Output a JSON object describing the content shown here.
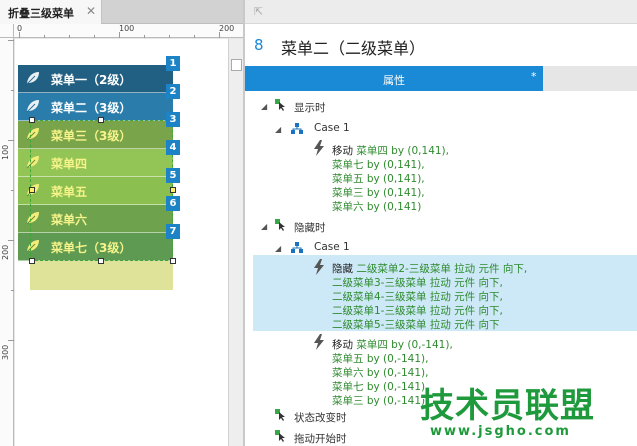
{
  "document_tab": {
    "title": "折叠三级菜单",
    "close": "✕"
  },
  "ruler": {
    "top_labels": [
      "0",
      "100",
      "200"
    ],
    "left_labels": [
      "100",
      "200",
      "300"
    ]
  },
  "canvas": {
    "menu_items": [
      {
        "label": "菜单一（2级）",
        "color": "#215f83"
      },
      {
        "label": "菜单二（3级）",
        "color": "#2a7dab"
      },
      {
        "label": "菜单三（3级）",
        "color": "#7aa44a"
      },
      {
        "label": "菜单四",
        "color": "#93c456"
      },
      {
        "label": "菜单五",
        "color": "#8bbf50"
      },
      {
        "label": "菜单六",
        "color": "#6fa24d"
      },
      {
        "label": "菜单七（3级）",
        "color": "#5e9a52"
      }
    ],
    "badges": [
      "1",
      "2",
      "3",
      "4",
      "5",
      "6",
      "7"
    ]
  },
  "panel": {
    "index": "8",
    "name": "菜单二（二级菜单）",
    "tab_label": "属性",
    "tab_marker": "*"
  },
  "tree": {
    "event_show": "显示时",
    "case1_a": "Case 1",
    "show_action": {
      "verb": "移动",
      "lines": [
        [
          "菜单四",
          " by (0,141),"
        ],
        [
          "菜单七",
          " by (0,141),"
        ],
        [
          "菜单五",
          " by (0,141),"
        ],
        [
          "菜单三",
          " by (0,141),"
        ],
        [
          "菜单六",
          " by (0,141)"
        ]
      ]
    },
    "event_hide": "隐藏时",
    "case1_b": "Case 1",
    "hide_action": {
      "verb": "隐藏",
      "lines": [
        [
          "二级菜单2-三级菜单",
          " 拉动 元件 向下,"
        ],
        [
          "二级菜单3-三级菜单",
          " 拉动 元件 向下,"
        ],
        [
          "二级菜单4-三级菜单",
          " 拉动 元件 向下,"
        ],
        [
          "二级菜单1-三级菜单",
          " 拉动 元件 向下,"
        ],
        [
          "二级菜单5-三级菜单",
          " 拉动 元件 向下"
        ]
      ]
    },
    "move_action": {
      "verb": "移动",
      "lines": [
        [
          "菜单四",
          " by (0,-141),"
        ],
        [
          "菜单五",
          " by (0,-141),"
        ],
        [
          "菜单六",
          " by (0,-141),"
        ],
        [
          "菜单七",
          " by (0,-141),"
        ],
        [
          "菜单三",
          " by (0,-141)"
        ]
      ]
    },
    "event_state": "状态改变时",
    "event_drag": "拖动开始时"
  },
  "watermark": {
    "big": "技术员联盟",
    "small": "www.jsgho.com"
  },
  "colors": {
    "accent": "#1a89d6",
    "action_green": "#2e8b2e",
    "selection": "#cde8f6"
  }
}
